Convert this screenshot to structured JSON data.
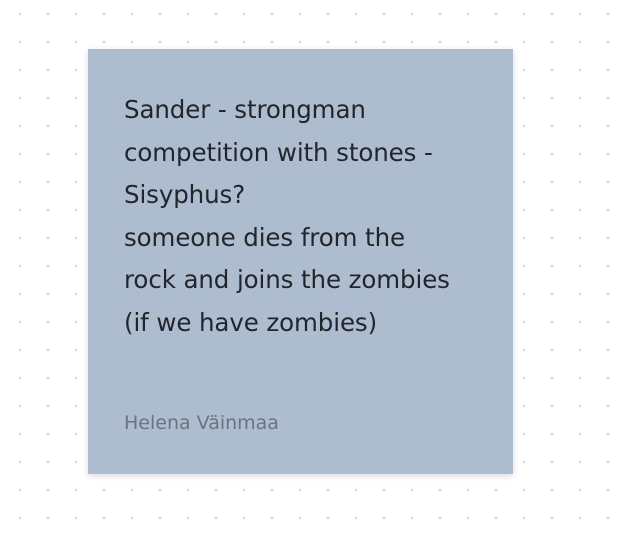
{
  "note": {
    "lines": [
      "Sander - strongman",
      "competition with stones -",
      "Sisyphus?",
      "someone dies from the",
      "rock and joins the zombies",
      "(if we have zombies)"
    ],
    "author": "Helena Väinmaa",
    "background_color": "#aebcd0"
  }
}
